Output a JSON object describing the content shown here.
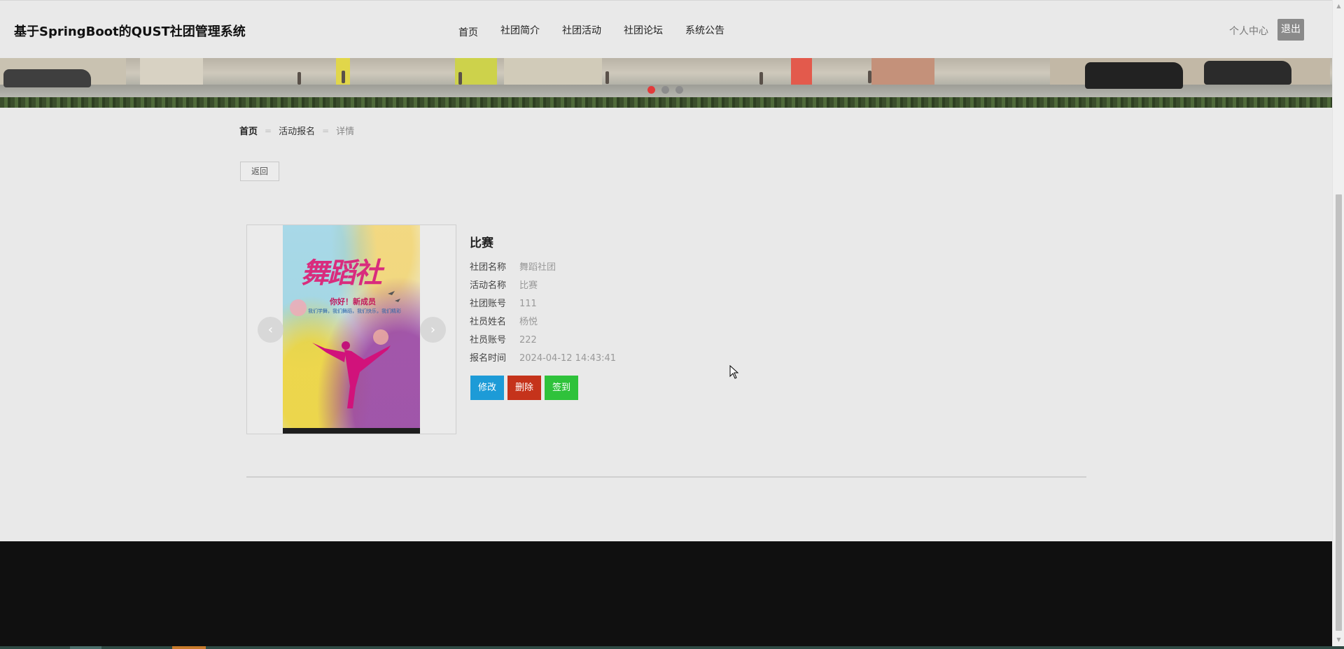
{
  "header": {
    "site_title": "基于SpringBoot的QUST社团管理系统",
    "nav": [
      "首页",
      "社团简介",
      "社团活动",
      "社团论坛",
      "系统公告"
    ],
    "user_center": "个人中心",
    "logout": "退出"
  },
  "banner": {
    "slide_count": 3,
    "active_slide": 1,
    "active_dot_color": "#e23a3a"
  },
  "breadcrumb": {
    "home": "首页",
    "section": "活动报名",
    "current": "详情",
    "separator": "="
  },
  "back_button": "返回",
  "poster": {
    "title": "舞蹈社",
    "subtitle": "你好！新成员",
    "tagline": "我们学舞，我们舞蹈，我们快乐，我们精彩"
  },
  "detail": {
    "title": "比赛",
    "fields": [
      {
        "label": "社团名称",
        "value": "舞蹈社团"
      },
      {
        "label": "活动名称",
        "value": "比赛"
      },
      {
        "label": "社团账号",
        "value": "111"
      },
      {
        "label": "社员姓名",
        "value": "杨悦"
      },
      {
        "label": "社员账号",
        "value": "222"
      },
      {
        "label": "报名时间",
        "value": "2024-04-12 14:43:41"
      }
    ]
  },
  "actions": {
    "edit": "修改",
    "delete": "删除",
    "sign_in": "签到"
  },
  "colors": {
    "edit": "#1d9bd7",
    "delete": "#c5331b",
    "sign_in": "#2fc23b",
    "footer": "#101010"
  }
}
